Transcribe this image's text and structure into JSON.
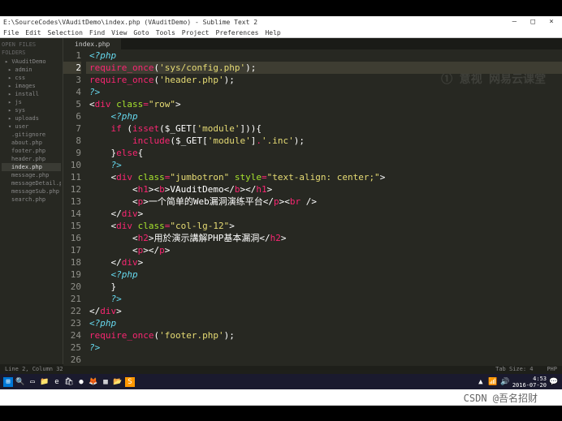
{
  "title": "E:\\SourceCodes\\VAuditDemo\\index.php (VAuditDemo) - Sublime Text 2",
  "menu": [
    "File",
    "Edit",
    "Selection",
    "Find",
    "View",
    "Goto",
    "Tools",
    "Project",
    "Preferences",
    "Help"
  ],
  "sidebar": {
    "open_files_hdr": "OPEN FILES",
    "folders_hdr": "FOLDERS",
    "items": [
      {
        "label": "▸ VAuditDemo",
        "lvl": 0
      },
      {
        "label": "▸ admin",
        "lvl": 1
      },
      {
        "label": "▸ css",
        "lvl": 1
      },
      {
        "label": "▸ images",
        "lvl": 1
      },
      {
        "label": "▸ install",
        "lvl": 1
      },
      {
        "label": "▸ js",
        "lvl": 1
      },
      {
        "label": "▸ sys",
        "lvl": 1
      },
      {
        "label": "▸ uploads",
        "lvl": 1
      },
      {
        "label": "▾ user",
        "lvl": 1
      },
      {
        "label": ".gitignore",
        "lvl": 2
      },
      {
        "label": "about.php",
        "lvl": 2
      },
      {
        "label": "footer.php",
        "lvl": 2
      },
      {
        "label": "header.php",
        "lvl": 2
      },
      {
        "label": "index.php",
        "lvl": 2,
        "sel": true
      },
      {
        "label": "message.php",
        "lvl": 2
      },
      {
        "label": "messageDetail.php",
        "lvl": 2
      },
      {
        "label": "messageSub.php",
        "lvl": 2
      },
      {
        "label": "search.php",
        "lvl": 2
      }
    ]
  },
  "tab": "index.php",
  "watermark": "① 意视  网易云课堂",
  "code": {
    "lines": [
      {
        "n": 1,
        "t": [
          [
            "kw",
            "<?php"
          ]
        ]
      },
      {
        "n": 2,
        "hl": true,
        "t": [
          [
            "fn",
            "require_once"
          ],
          [
            "br",
            "("
          ],
          [
            "st",
            "'sys/config.php'"
          ],
          [
            "br",
            ")"
          ],
          [
            "pu",
            ";"
          ]
        ]
      },
      {
        "n": 3,
        "t": [
          [
            "fn",
            "require_once"
          ],
          [
            "br",
            "("
          ],
          [
            "st",
            "'header.php'"
          ],
          [
            "br",
            ")"
          ],
          [
            "pu",
            ";"
          ]
        ]
      },
      {
        "n": 4,
        "t": [
          [
            "kw",
            "?>"
          ]
        ]
      },
      {
        "n": 5,
        "t": [
          [
            "br",
            "<"
          ],
          [
            "tg",
            "div"
          ],
          [
            "pu",
            " "
          ],
          [
            "at",
            "class"
          ],
          [
            "op",
            "="
          ],
          [
            "st",
            "\"row\""
          ],
          [
            "br",
            ">"
          ]
        ]
      },
      {
        "n": 6,
        "t": [
          [
            "pu",
            "    "
          ],
          [
            "kw",
            "<?php"
          ]
        ]
      },
      {
        "n": 7,
        "t": [
          [
            "pu",
            "    "
          ],
          [
            "fn",
            "if"
          ],
          [
            "pu",
            " "
          ],
          [
            "br",
            "("
          ],
          [
            "fn",
            "isset"
          ],
          [
            "br",
            "("
          ],
          [
            "va",
            "$_GET"
          ],
          [
            "br",
            "["
          ],
          [
            "st",
            "'module'"
          ],
          [
            "br",
            "]))"
          ],
          [
            "br",
            "{"
          ]
        ]
      },
      {
        "n": 8,
        "t": [
          [
            "pu",
            "        "
          ],
          [
            "fn",
            "include"
          ],
          [
            "br",
            "("
          ],
          [
            "va",
            "$_GET"
          ],
          [
            "br",
            "["
          ],
          [
            "st",
            "'module'"
          ],
          [
            "br",
            "]"
          ],
          [
            "op",
            "."
          ],
          [
            "st",
            "'.inc'"
          ],
          [
            "br",
            ")"
          ],
          [
            "pu",
            ";"
          ]
        ]
      },
      {
        "n": 9,
        "t": [
          [
            "pu",
            "    "
          ],
          [
            "br",
            "}"
          ],
          [
            "fn",
            "else"
          ],
          [
            "br",
            "{"
          ]
        ]
      },
      {
        "n": 10,
        "t": [
          [
            "pu",
            "    "
          ],
          [
            "kw",
            "?>"
          ]
        ]
      },
      {
        "n": 11,
        "t": [
          [
            "pu",
            "    "
          ],
          [
            "br",
            "<"
          ],
          [
            "tg",
            "div"
          ],
          [
            "pu",
            " "
          ],
          [
            "at",
            "class"
          ],
          [
            "op",
            "="
          ],
          [
            "st",
            "\"jumbotron\""
          ],
          [
            "pu",
            " "
          ],
          [
            "at",
            "style"
          ],
          [
            "op",
            "="
          ],
          [
            "st",
            "\"text-align: center;\""
          ],
          [
            "br",
            ">"
          ]
        ]
      },
      {
        "n": 12,
        "t": [
          [
            "pu",
            "        "
          ],
          [
            "br",
            "<"
          ],
          [
            "tg",
            "h1"
          ],
          [
            "br",
            "><"
          ],
          [
            "tg",
            "b"
          ],
          [
            "br",
            ">"
          ],
          [
            "ht",
            "VAuditDemo"
          ],
          [
            "br",
            "</"
          ],
          [
            "tg",
            "b"
          ],
          [
            "br",
            "></"
          ],
          [
            "tg",
            "h1"
          ],
          [
            "br",
            ">"
          ]
        ]
      },
      {
        "n": 13,
        "t": [
          [
            "pu",
            "        "
          ],
          [
            "br",
            "<"
          ],
          [
            "tg",
            "p"
          ],
          [
            "br",
            ">"
          ],
          [
            "ht",
            "一个简单的Web漏洞演练平台"
          ],
          [
            "br",
            "</"
          ],
          [
            "tg",
            "p"
          ],
          [
            "br",
            "><"
          ],
          [
            "tg",
            "br"
          ],
          [
            "pu",
            " "
          ],
          [
            "br",
            "/>"
          ]
        ]
      },
      {
        "n": 14,
        "t": [
          [
            "pu",
            "    "
          ],
          [
            "br",
            "</"
          ],
          [
            "tg",
            "div"
          ],
          [
            "br",
            ">"
          ]
        ]
      },
      {
        "n": 15,
        "t": [
          [
            "pu",
            "    "
          ],
          [
            "br",
            "<"
          ],
          [
            "tg",
            "div"
          ],
          [
            "pu",
            " "
          ],
          [
            "at",
            "class"
          ],
          [
            "op",
            "="
          ],
          [
            "st",
            "\"col-lg-12\""
          ],
          [
            "br",
            ">"
          ]
        ]
      },
      {
        "n": 16,
        "t": [
          [
            "pu",
            "        "
          ],
          [
            "br",
            "<"
          ],
          [
            "tg",
            "h2"
          ],
          [
            "br",
            ">"
          ],
          [
            "ht",
            "用於演示講解PHP基本漏洞"
          ],
          [
            "br",
            "</"
          ],
          [
            "tg",
            "h2"
          ],
          [
            "br",
            ">"
          ]
        ]
      },
      {
        "n": 17,
        "t": [
          [
            "pu",
            "        "
          ],
          [
            "br",
            "<"
          ],
          [
            "tg",
            "p"
          ],
          [
            "br",
            "></"
          ],
          [
            "tg",
            "p"
          ],
          [
            "br",
            ">"
          ]
        ]
      },
      {
        "n": 18,
        "t": [
          [
            "pu",
            "    "
          ],
          [
            "br",
            "</"
          ],
          [
            "tg",
            "div"
          ],
          [
            "br",
            ">"
          ]
        ]
      },
      {
        "n": 19,
        "t": [
          [
            "pu",
            "    "
          ],
          [
            "kw",
            "<?php"
          ]
        ]
      },
      {
        "n": 20,
        "t": [
          [
            "pu",
            "    "
          ],
          [
            "br",
            "}"
          ]
        ]
      },
      {
        "n": 21,
        "t": [
          [
            "pu",
            "    "
          ],
          [
            "kw",
            "?>"
          ]
        ]
      },
      {
        "n": 22,
        "t": [
          [
            "br",
            "</"
          ],
          [
            "tg",
            "div"
          ],
          [
            "br",
            ">"
          ]
        ]
      },
      {
        "n": 23,
        "t": [
          [
            "pu",
            ""
          ]
        ]
      },
      {
        "n": 24,
        "t": [
          [
            "kw",
            "<?php"
          ]
        ]
      },
      {
        "n": 25,
        "t": [
          [
            "fn",
            "require_once"
          ],
          [
            "br",
            "("
          ],
          [
            "st",
            "'footer.php'"
          ],
          [
            "br",
            ")"
          ],
          [
            "pu",
            ";"
          ]
        ]
      },
      {
        "n": 26,
        "t": [
          [
            "kw",
            "?>"
          ]
        ]
      }
    ]
  },
  "status": {
    "left": "Line 2, Column 32",
    "right_tab": "Tab Size: 4",
    "right_lang": "PHP"
  },
  "taskbar": {
    "time": "4:53",
    "date": "2016-07-20"
  },
  "attribution": "CSDN @吾名招财"
}
